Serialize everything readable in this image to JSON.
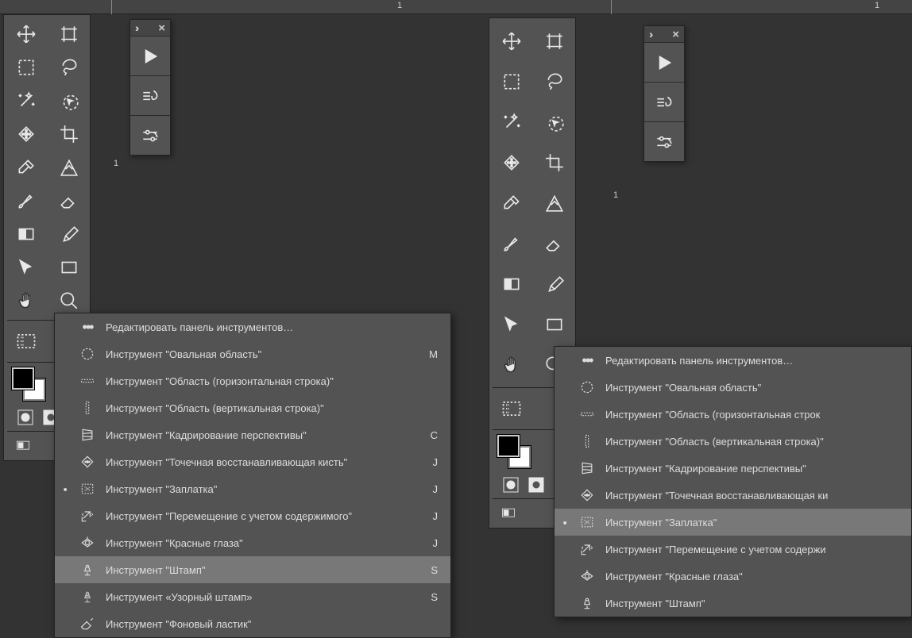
{
  "ruler": {
    "label1": "1"
  },
  "toolbox": {
    "tools": [
      "move-icon",
      "artboard-icon",
      "marquee-icon",
      "lasso-icon",
      "wand-icon",
      "quickselect-icon",
      "healing-icon",
      "crop-icon",
      "eyedropper-icon",
      "frame-icon",
      "brush-icon",
      "eraser-icon",
      "gradient-icon",
      "pen-icon",
      "pathselect-icon",
      "rect-icon",
      "hand-icon",
      "zoom-icon"
    ],
    "extra": "extra-tools-icon"
  },
  "floatPanel": {
    "items": [
      "play-icon",
      "brushpanel-icon",
      "sliders-icon"
    ]
  },
  "menuA": {
    "header": "Редактировать панель инструментов…",
    "items": [
      {
        "icon": "ellipse-marquee-icon",
        "label": "Инструмент \"Овальная область\"",
        "key": "M"
      },
      {
        "icon": "row-marquee-icon",
        "label": "Инструмент \"Область (горизонтальная строка)\""
      },
      {
        "icon": "col-marquee-icon",
        "label": "Инструмент \"Область (вертикальная строка)\""
      },
      {
        "icon": "persp-crop-icon",
        "label": "Инструмент \"Кадрирование перспективы\"",
        "key": "C"
      },
      {
        "icon": "spot-heal-icon",
        "label": "Инструмент \"Точечная восстанавливающая кисть\"",
        "key": "J"
      },
      {
        "icon": "patch-icon",
        "label": "Инструмент \"Заплатка\"",
        "key": "J",
        "mark": true
      },
      {
        "icon": "content-move-icon",
        "label": "Инструмент \"Перемещение с учетом содержимого\"",
        "key": "J"
      },
      {
        "icon": "redeye-icon",
        "label": "Инструмент \"Красные глаза\"",
        "key": "J"
      },
      {
        "icon": "clone-stamp-icon",
        "label": "Инструмент \"Штамп\"",
        "key": "S",
        "hl": true
      },
      {
        "icon": "pattern-stamp-icon",
        "label": "Инструмент «Узорный штамп»",
        "key": "S"
      },
      {
        "icon": "bg-eraser-icon",
        "label": "Инструмент \"Фоновый ластик\"",
        "key": ""
      }
    ]
  },
  "menuB": {
    "header": "Редактировать панель инструментов…",
    "items": [
      {
        "icon": "ellipse-marquee-icon",
        "label": "Инструмент \"Овальная область\""
      },
      {
        "icon": "row-marquee-icon",
        "label": "Инструмент \"Область (горизонтальная строк"
      },
      {
        "icon": "col-marquee-icon",
        "label": "Инструмент \"Область (вертикальная строка)\""
      },
      {
        "icon": "persp-crop-icon",
        "label": "Инструмент \"Кадрирование перспективы\""
      },
      {
        "icon": "spot-heal-icon",
        "label": "Инструмент \"Точечная восстанавливающая ки"
      },
      {
        "icon": "patch-icon",
        "label": "Инструмент \"Заплатка\"",
        "mark": true,
        "hl": true
      },
      {
        "icon": "content-move-icon",
        "label": "Инструмент \"Перемещение с учетом содержи"
      },
      {
        "icon": "redeye-icon",
        "label": "Инструмент \"Красные глаза\""
      },
      {
        "icon": "clone-stamp-icon",
        "label": "Инструмент \"Штамп\""
      }
    ]
  }
}
